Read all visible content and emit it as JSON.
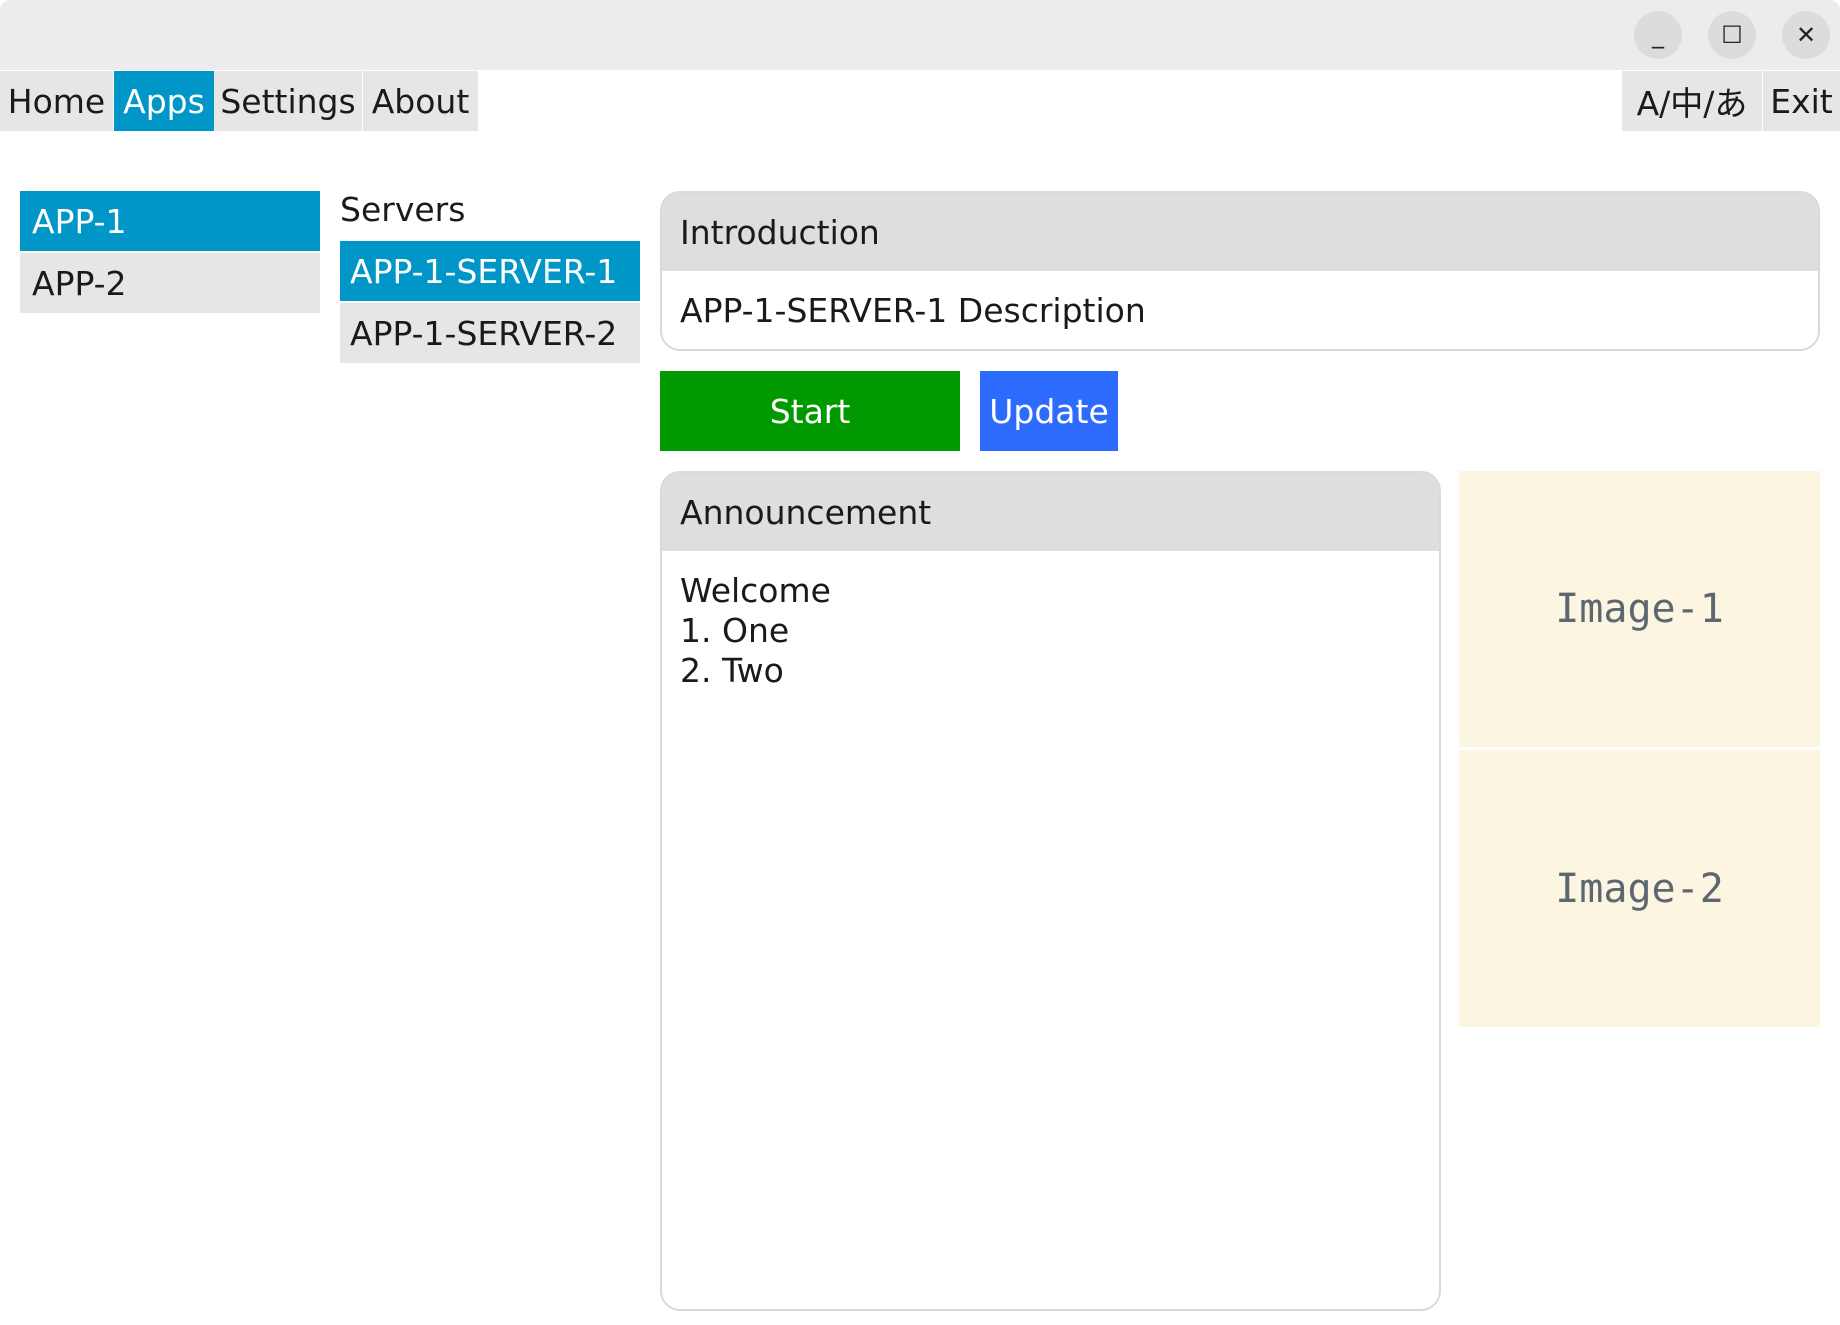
{
  "window": {
    "minimize_glyph": "_",
    "maximize_glyph": "☐",
    "close_glyph": "✕"
  },
  "menu": {
    "items": [
      {
        "label": "Home"
      },
      {
        "label": "Apps",
        "active": true
      },
      {
        "label": "Settings"
      },
      {
        "label": "About"
      }
    ],
    "language_label": "A/中/あ",
    "exit_label": "Exit"
  },
  "apps": {
    "items": [
      {
        "label": "APP-1",
        "active": true
      },
      {
        "label": "APP-2"
      }
    ]
  },
  "servers": {
    "label": "Servers",
    "items": [
      {
        "label": "APP-1-SERVER-1",
        "active": true
      },
      {
        "label": "APP-1-SERVER-2"
      }
    ]
  },
  "introduction": {
    "title": "Introduction",
    "description": "APP-1-SERVER-1 Description"
  },
  "actions": {
    "start_label": "Start",
    "update_label": "Update"
  },
  "announcement": {
    "title": "Announcement",
    "lines": [
      "Welcome",
      "1. One",
      "2. Two"
    ]
  },
  "images": {
    "items": [
      {
        "label": "Image-1"
      },
      {
        "label": "Image-2"
      }
    ]
  },
  "colors": {
    "accent": "#0096c8",
    "start_button": "#009900",
    "update_button": "#2d6bff",
    "image_background": "#fcf5e1"
  }
}
